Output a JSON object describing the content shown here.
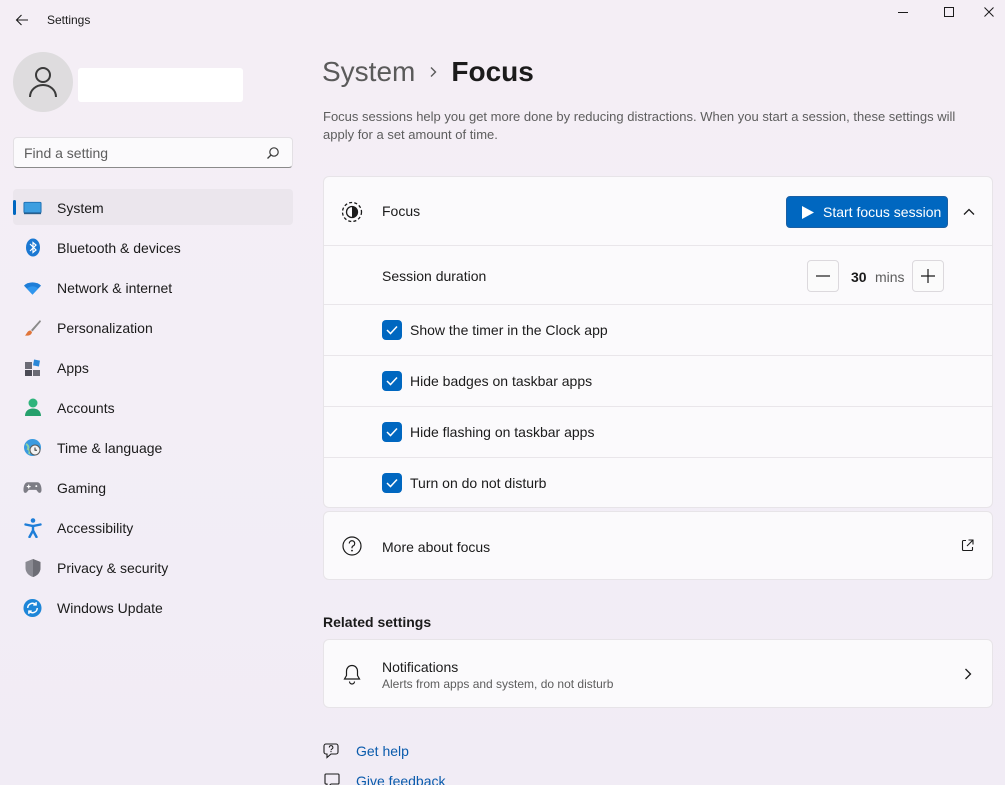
{
  "window": {
    "title": "Settings",
    "icons": {
      "back": "back-arrow-icon",
      "minimize": "minimize-icon",
      "maximize": "maximize-icon",
      "close": "close-icon"
    }
  },
  "search": {
    "placeholder": "Find a setting",
    "value": ""
  },
  "sidebar": {
    "items": [
      {
        "label": "System",
        "icon": "monitor-icon",
        "selected": true
      },
      {
        "label": "Bluetooth & devices",
        "icon": "bluetooth-icon"
      },
      {
        "label": "Network & internet",
        "icon": "wifi-icon"
      },
      {
        "label": "Personalization",
        "icon": "brush-icon"
      },
      {
        "label": "Apps",
        "icon": "apps-icon"
      },
      {
        "label": "Accounts",
        "icon": "person-icon"
      },
      {
        "label": "Time & language",
        "icon": "globe-clock-icon"
      },
      {
        "label": "Gaming",
        "icon": "gamepad-icon"
      },
      {
        "label": "Accessibility",
        "icon": "accessibility-icon"
      },
      {
        "label": "Privacy & security",
        "icon": "shield-icon"
      },
      {
        "label": "Windows Update",
        "icon": "update-icon"
      }
    ]
  },
  "breadcrumb": {
    "parent": "System",
    "current": "Focus"
  },
  "description": "Focus sessions help you get more done by reducing distractions. When you start a session, these settings will apply for a set amount of time.",
  "focus": {
    "label": "Focus",
    "start_button": "Start focus session",
    "session_duration_label": "Session duration",
    "duration_value": "30",
    "duration_unit": "mins",
    "options": [
      {
        "label": "Show the timer in the Clock app",
        "checked": true
      },
      {
        "label": "Hide badges on taskbar apps",
        "checked": true
      },
      {
        "label": "Hide flashing on taskbar apps",
        "checked": true
      },
      {
        "label": "Turn on do not disturb",
        "checked": true
      }
    ]
  },
  "about": {
    "label": "More about focus"
  },
  "related": {
    "title": "Related settings",
    "notifications": {
      "title": "Notifications",
      "subtitle": "Alerts from apps and system, do not disturb"
    }
  },
  "footer": {
    "get_help": "Get help",
    "give_feedback": "Give feedback"
  },
  "colors": {
    "accent": "#0067c0",
    "link": "#0a5bac"
  }
}
